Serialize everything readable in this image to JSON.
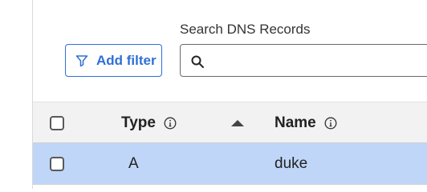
{
  "filters": {
    "add_filter_label": "Add filter",
    "search_label": "Search DNS Records",
    "search_value": "",
    "search_placeholder": ""
  },
  "table": {
    "columns": [
      {
        "label": "Type",
        "sort": "ascending"
      },
      {
        "label": "Name"
      }
    ],
    "rows": [
      {
        "type": "A",
        "name": "duke",
        "selected": false
      }
    ]
  },
  "colors": {
    "accent": "#2f6fd6",
    "row_highlight": "#bfd6f8",
    "header_background": "#f2f2f2"
  },
  "icons": [
    "filter-icon",
    "search-icon",
    "info-icon",
    "sort-ascending-icon"
  ]
}
